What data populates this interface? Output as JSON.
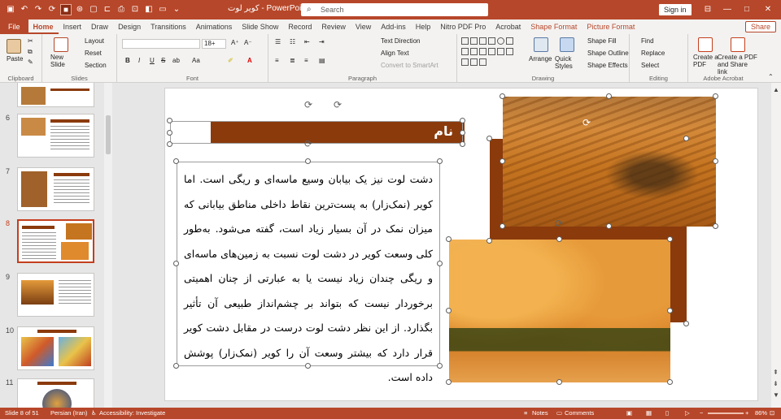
{
  "window": {
    "title": "کویر لوت  -  PowerPoint",
    "search_placeholder": "Search",
    "signin_label": "Sign in",
    "minimize": "—",
    "restore": "□",
    "close": "✕"
  },
  "tabs": [
    "Home",
    "Insert",
    "Draw",
    "Design",
    "Transitions",
    "Animations",
    "Slide Show",
    "Record",
    "Review",
    "View",
    "Add-ins",
    "Help",
    "Nitro PDF Pro",
    "Acrobat",
    "Shape Format",
    "Picture Format"
  ],
  "file_tab": "File",
  "share_label": "Share",
  "ribbon": {
    "clipboard": {
      "label": "Clipboard",
      "paste": "Paste"
    },
    "slides": {
      "label": "Slides",
      "new_slide": "New Slide",
      "layout": "Layout",
      "reset": "Reset",
      "section": "Section"
    },
    "font": {
      "label": "Font",
      "size": "18+",
      "bold": "B",
      "italic": "I",
      "underline": "U",
      "strike": "S",
      "shadow": "ab",
      "aa": "Aa"
    },
    "paragraph": {
      "label": "Paragraph",
      "text_direction": "Text Direction",
      "align_text": "Align Text",
      "convert_smartart": "Convert to SmartArt"
    },
    "drawing": {
      "label": "Drawing",
      "arrange": "Arrange",
      "quick_styles": "Quick Styles",
      "shape_fill": "Shape Fill",
      "shape_outline": "Shape Outline",
      "shape_effects": "Shape Effects"
    },
    "editing": {
      "label": "Editing",
      "find": "Find",
      "replace": "Replace",
      "select": "Select"
    },
    "acrobat": {
      "label": "Adobe Acrobat",
      "create_pdf": "Create a PDF",
      "create_share": "Create a PDF and Share link"
    }
  },
  "thumbnails": [
    {
      "number": "6"
    },
    {
      "number": "7"
    },
    {
      "number": "8",
      "selected": true
    },
    {
      "number": "9"
    },
    {
      "number": "10"
    },
    {
      "number": "11"
    }
  ],
  "slide": {
    "title": "نام",
    "body": "دشت لوت نیز یک بیابان وسیع ماسه‌ای و ریگی است. اما کویر (نمک‌زار) به پست‌ترین نقاط داخلی مناطق بیابانی که میزان نمک در آن بسیار زیاد است، گفته می‌شود. به‌طور کلی وسعت کویر در دشت لوت نسبت به زمین‌های ماسه‌ای و ریگی چندان زیاد نیست یا به عبارتی از چنان اهمیتی برخوردار نیست که بتواند بر چشم‌انداز طبیعی آن تأثیر بگذارد. از این نظر دشت لوت درست در مقابل دشت کویر قرار دارد که بیشتر وسعت آن را کویر (نمک‌زار) پوشش داده است."
  },
  "status": {
    "slide_info": "Slide 8 of 51",
    "language": "Persian (Iran)",
    "accessibility": "Accessibility: Investigate",
    "notes": "Notes",
    "comments": "Comments",
    "zoom": "86%"
  }
}
